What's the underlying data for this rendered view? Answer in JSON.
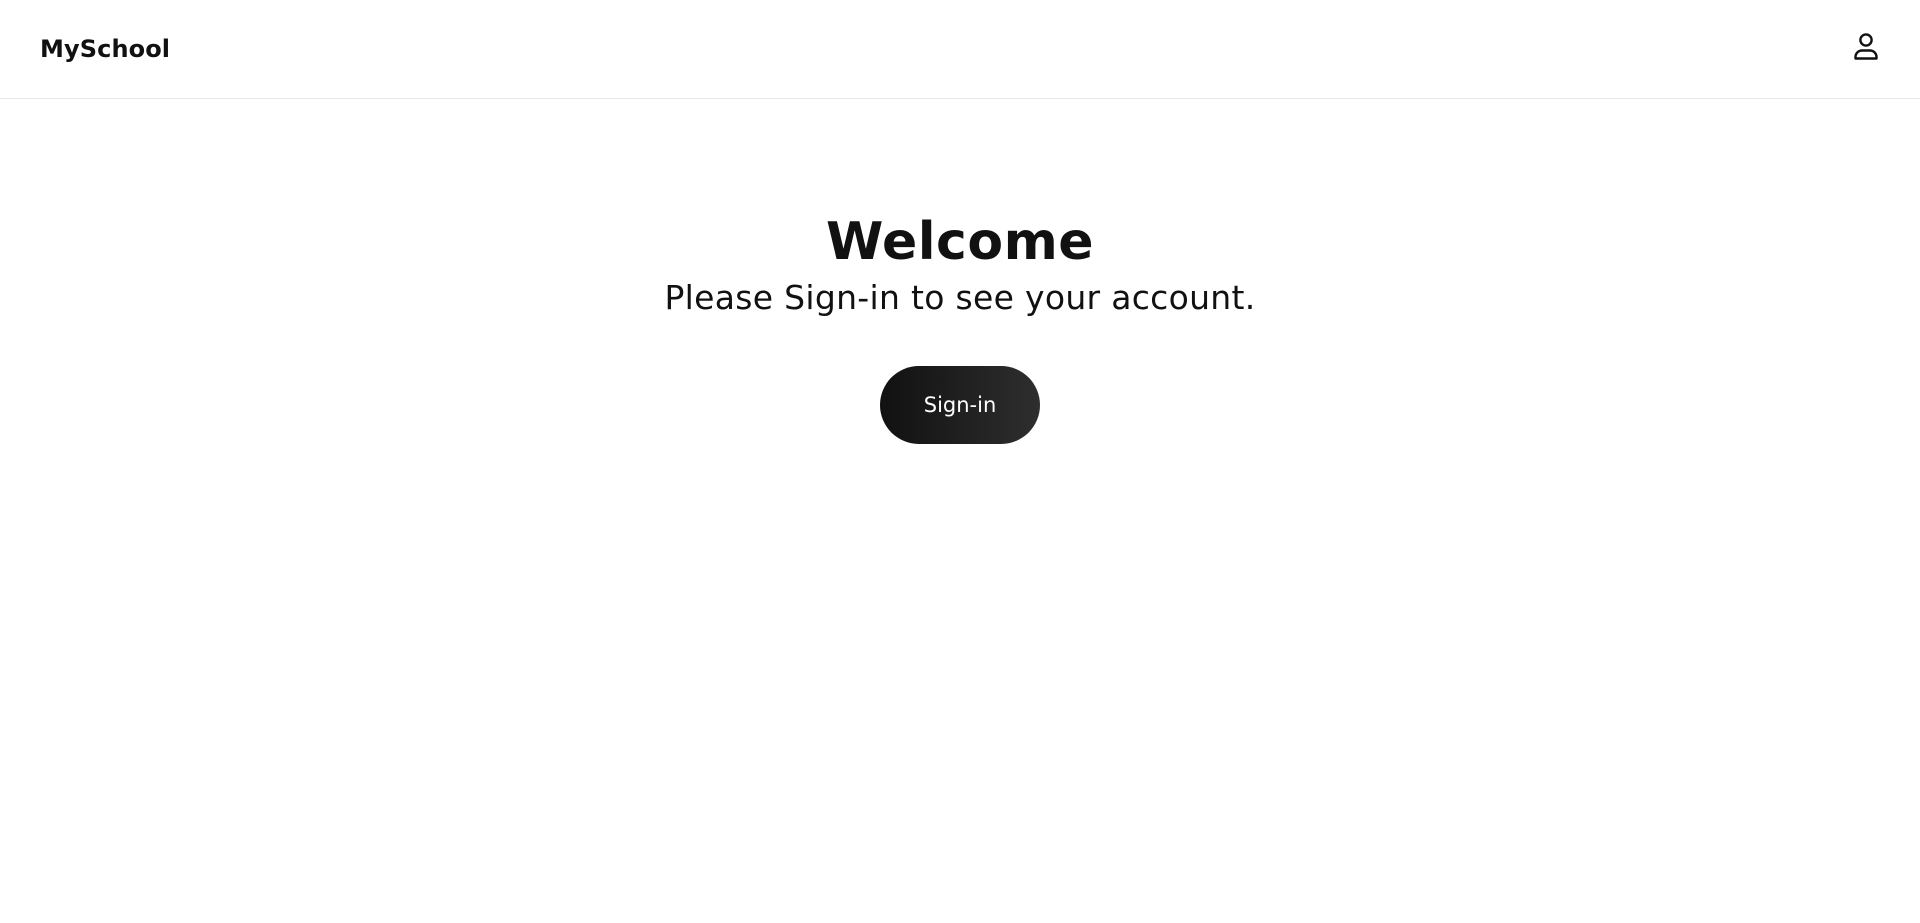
{
  "header": {
    "brand": "MySchool",
    "account_icon": "user-icon"
  },
  "main": {
    "title": "Welcome",
    "subtitle": "Please Sign-in to see your account.",
    "signin_label": "Sign-in"
  },
  "colors": {
    "background": "#ffffff",
    "text": "#111111",
    "button_start": "#111111",
    "button_end": "#2e2e2e",
    "button_text": "#ffffff",
    "divider": "#e6e6e6"
  }
}
